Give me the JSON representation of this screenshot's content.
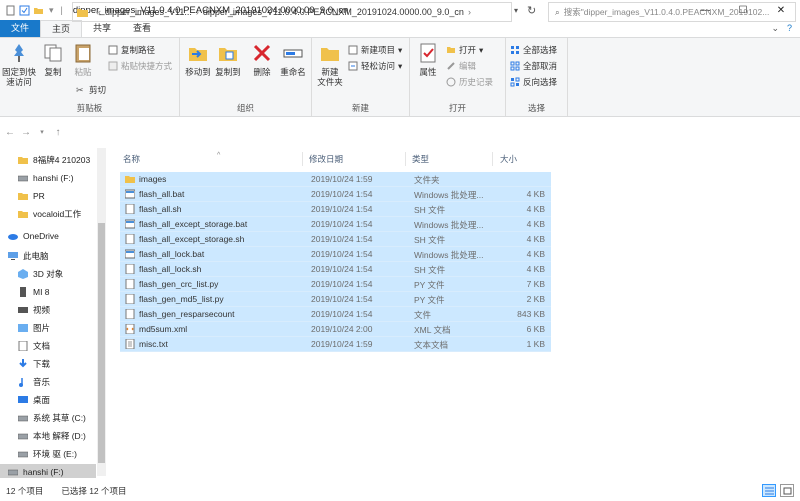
{
  "window": {
    "title": "dipper_images_V11.0.4.0.PEACNXM_20191024.0000.00_9.0_cn",
    "minimize": "—",
    "maximize": "☐",
    "close": "✕"
  },
  "tabs": [
    "文件",
    "主页",
    "共享",
    "查看"
  ],
  "ribbon": {
    "clipboard": {
      "label": "剪贴板",
      "pin": "固定到快速访问",
      "copy": "复制",
      "paste": "粘贴",
      "cut": "剪切",
      "copy_path": "复制路径",
      "paste_shortcut": "粘贴快捷方式"
    },
    "organize": {
      "label": "组织",
      "move_to": "移动到",
      "copy_to": "复制到",
      "delete": "删除",
      "rename": "重命名"
    },
    "new": {
      "label": "新建",
      "new_folder": "新建\n文件夹",
      "new_item": "新建项目",
      "easy_access": "轻松访问"
    },
    "open": {
      "label": "打开",
      "properties": "属性",
      "open": "打开",
      "edit": "编辑",
      "history": "历史记录"
    },
    "select": {
      "label": "选择",
      "select_all": "全部选择",
      "select_none": "全部取消",
      "invert": "反向选择"
    }
  },
  "address": {
    "crumb1": "dipper_images_V11...",
    "crumb2": "dipper_images_V11.0.4.0.PEACNXM_20191024.0000.00_9.0_cn",
    "search_placeholder": "搜索\"dipper_images_V11.0.4.0.PEACNXM_2019102..."
  },
  "nav": [
    {
      "label": "8福牌4 210203",
      "icon": "folder-icon"
    },
    {
      "label": "hanshi (F:)",
      "icon": "drive-icon"
    },
    {
      "label": "PR",
      "icon": "folder-icon"
    },
    {
      "label": "vocaloid工作",
      "icon": "folder-icon"
    },
    {
      "label": "OneDrive",
      "icon": "cloud-icon"
    },
    {
      "label": "此电脑",
      "icon": "computer-icon"
    },
    {
      "label": "3D 对象",
      "icon": "cube-icon"
    },
    {
      "label": "MI 8",
      "icon": "phone-icon"
    },
    {
      "label": "视频",
      "icon": "video-icon"
    },
    {
      "label": "图片",
      "icon": "picture-icon"
    },
    {
      "label": "文档",
      "icon": "document-icon"
    },
    {
      "label": "下载",
      "icon": "download-icon"
    },
    {
      "label": "音乐",
      "icon": "music-icon"
    },
    {
      "label": "桌面",
      "icon": "desktop-icon"
    },
    {
      "label": "系统 其草 (C:)",
      "icon": "drive-icon"
    },
    {
      "label": "本地 解释 (D:)",
      "icon": "drive-icon"
    },
    {
      "label": "环境 驱 (E:)",
      "icon": "drive-icon"
    },
    {
      "label": "hanshi (F:)",
      "icon": "drive-icon"
    }
  ],
  "columns": {
    "name": "名称",
    "date": "修改日期",
    "type": "类型",
    "size": "大小"
  },
  "files": [
    {
      "name": "images",
      "date": "2019/10/24 1:59",
      "type": "文件夹",
      "size": "",
      "icon": "folder"
    },
    {
      "name": "flash_all.bat",
      "date": "2019/10/24 1:54",
      "type": "Windows 批处理...",
      "size": "4 KB",
      "icon": "bat"
    },
    {
      "name": "flash_all.sh",
      "date": "2019/10/24 1:54",
      "type": "SH 文件",
      "size": "4 KB",
      "icon": "file"
    },
    {
      "name": "flash_all_except_storage.bat",
      "date": "2019/10/24 1:54",
      "type": "Windows 批处理...",
      "size": "4 KB",
      "icon": "bat"
    },
    {
      "name": "flash_all_except_storage.sh",
      "date": "2019/10/24 1:54",
      "type": "SH 文件",
      "size": "4 KB",
      "icon": "file"
    },
    {
      "name": "flash_all_lock.bat",
      "date": "2019/10/24 1:54",
      "type": "Windows 批处理...",
      "size": "4 KB",
      "icon": "bat"
    },
    {
      "name": "flash_all_lock.sh",
      "date": "2019/10/24 1:54",
      "type": "SH 文件",
      "size": "4 KB",
      "icon": "file"
    },
    {
      "name": "flash_gen_crc_list.py",
      "date": "2019/10/24 1:54",
      "type": "PY 文件",
      "size": "7 KB",
      "icon": "file"
    },
    {
      "name": "flash_gen_md5_list.py",
      "date": "2019/10/24 1:54",
      "type": "PY 文件",
      "size": "2 KB",
      "icon": "file"
    },
    {
      "name": "flash_gen_resparsecount",
      "date": "2019/10/24 1:54",
      "type": "文件",
      "size": "843 KB",
      "icon": "file"
    },
    {
      "name": "md5sum.xml",
      "date": "2019/10/24 2:00",
      "type": "XML 文档",
      "size": "6 KB",
      "icon": "xml"
    },
    {
      "name": "misc.txt",
      "date": "2019/10/24 1:59",
      "type": "文本文档",
      "size": "1 KB",
      "icon": "txt"
    }
  ],
  "status": {
    "count": "12 个项目",
    "selected": "已选择 12 个项目"
  },
  "colors": {
    "accent": "#1979ca",
    "selection": "#cce8ff",
    "folder": "#f0c14b"
  }
}
